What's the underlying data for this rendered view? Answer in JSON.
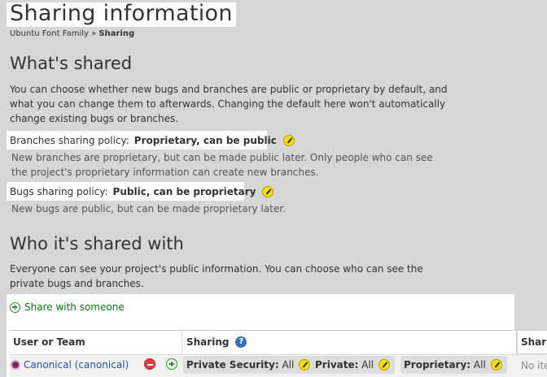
{
  "page": {
    "title": "Sharing information",
    "breadcrumb": {
      "parent": "Ubuntu Font Family",
      "separator": "»",
      "current": "Sharing"
    }
  },
  "whats_shared": {
    "heading": "What's shared",
    "description": "You can choose whether new bugs and branches are public or proprietary by default, and what you can change them to afterwards. Changing the default here won't automatically change existing bugs or branches.",
    "branches": {
      "label": "Branches sharing policy:",
      "value": "Proprietary, can be public",
      "note": "New branches are proprietary, but can be made public later. Only people who can see the project's proprietary information can create new branches."
    },
    "bugs": {
      "label": "Bugs sharing policy:",
      "value": "Public, can be proprietary",
      "note": "New bugs are public, but can be made proprietary later."
    }
  },
  "who_shared": {
    "heading": "Who it's shared with",
    "description": "Everyone can see your project's public information. You can choose who can see the private bugs and branches.",
    "share_link": "Share with someone",
    "table": {
      "columns": [
        "User or Team",
        "Sharing",
        "Share"
      ],
      "rows": [
        {
          "name": "Canonical (canonical)",
          "chips": [
            {
              "label": "Private Security:",
              "value": "All"
            },
            {
              "label": "Private:",
              "value": "All"
            },
            {
              "label": "Proprietary:",
              "value": "All"
            }
          ],
          "shared_items": "No ite"
        }
      ]
    }
  },
  "icons": {
    "edit": "pencil-edit-icon",
    "add": "plus-circle-icon",
    "remove": "minus-circle-icon",
    "help": "question-icon",
    "person": "team-icon"
  },
  "colors": {
    "background": "#d7d7d7",
    "link": "#2b4fa0",
    "share_link": "#0d7a0d",
    "edit_icon": "#f5e000",
    "remove_icon": "#d94040",
    "help_icon": "#3a6fb5"
  }
}
